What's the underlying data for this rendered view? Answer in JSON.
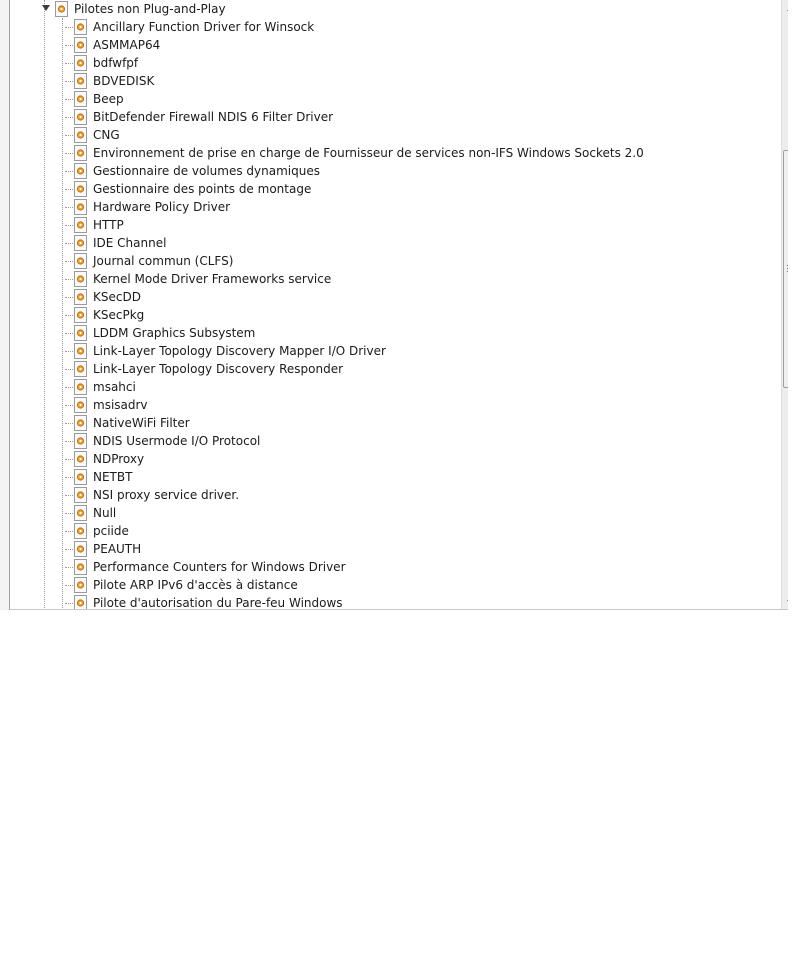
{
  "tree": {
    "root": {
      "label": "Pilotes non Plug-and-Play",
      "icon": "service-gear-icon",
      "expanded": true
    },
    "children": [
      "Ancillary Function Driver for Winsock",
      "ASMMAP64",
      "bdfwfpf",
      "BDVEDISK",
      "Beep",
      "BitDefender Firewall NDIS 6 Filter Driver",
      "CNG",
      "Environnement de prise en charge de Fournisseur de services non-IFS Windows Sockets 2.0",
      "Gestionnaire de volumes dynamiques",
      "Gestionnaire des points de montage",
      "Hardware Policy Driver",
      "HTTP",
      "IDE Channel",
      "Journal commun (CLFS)",
      "Kernel Mode Driver Frameworks service",
      "KSecDD",
      "KSecPkg",
      "LDDM Graphics Subsystem",
      "Link-Layer Topology Discovery Mapper I/O Driver",
      "Link-Layer Topology Discovery Responder",
      "msahci",
      "msisadrv",
      "NativeWiFi Filter",
      "NDIS Usermode I/O Protocol",
      "NDProxy",
      "NETBT",
      "NSI proxy service driver.",
      "Null",
      "pciide",
      "PEAUTH",
      "Performance Counters for Windows Driver",
      "Pilote ARP IPv6 d'accès à distance",
      "Pilote d'autorisation du Pare-feu Windows"
    ]
  },
  "icons": {
    "service": "service-gear-icon",
    "expander": "expanded-arrow-icon"
  },
  "colors": {
    "gear": "#d08a18",
    "page": "#ffffff",
    "text": "#1b1b1b"
  }
}
